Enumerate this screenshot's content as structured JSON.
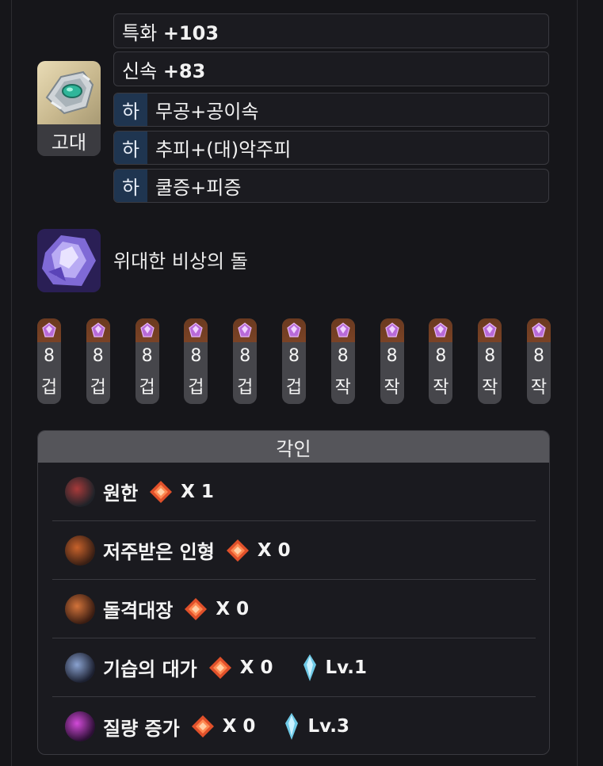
{
  "accessory": {
    "grade": "고대",
    "stats": [
      {
        "name": "특화",
        "value": "+103"
      },
      {
        "name": "신속",
        "value": "+83"
      }
    ],
    "effects": [
      {
        "tier": "하",
        "label": "무공+공이속"
      },
      {
        "tier": "하",
        "label": "추피+(대)악주피"
      },
      {
        "tier": "하",
        "label": "쿨증+피증"
      }
    ]
  },
  "stone": {
    "name": "위대한 비상의 돌"
  },
  "gems": [
    {
      "level": "8",
      "kind": "겁"
    },
    {
      "level": "8",
      "kind": "겁"
    },
    {
      "level": "8",
      "kind": "겁"
    },
    {
      "level": "8",
      "kind": "겁"
    },
    {
      "level": "8",
      "kind": "겁"
    },
    {
      "level": "8",
      "kind": "겁"
    },
    {
      "level": "8",
      "kind": "작"
    },
    {
      "level": "8",
      "kind": "작"
    },
    {
      "level": "8",
      "kind": "작"
    },
    {
      "level": "8",
      "kind": "작"
    },
    {
      "level": "8",
      "kind": "작"
    }
  ],
  "engravings": {
    "title": "각인",
    "items": [
      {
        "name": "원한",
        "count": "X 1",
        "level": ""
      },
      {
        "name": "저주받은 인형",
        "count": "X 0",
        "level": ""
      },
      {
        "name": "돌격대장",
        "count": "X 0",
        "level": ""
      },
      {
        "name": "기습의 대가",
        "count": "X 0",
        "level": "Lv.1"
      },
      {
        "name": "질량 증가",
        "count": "X 0",
        "level": "Lv.3"
      }
    ]
  },
  "colors": {
    "background": "#16161a",
    "tier_badge": "#1f3550",
    "relic_stone": "#e0502a",
    "ability_gem": "#6ec9e6",
    "gem_cap": "#7a4326"
  }
}
